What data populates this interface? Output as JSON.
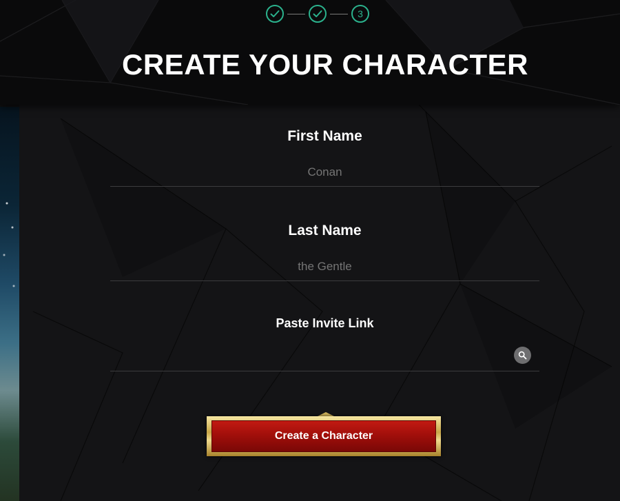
{
  "stepper": {
    "steps": [
      {
        "state": "complete",
        "icon": "check-icon",
        "label": ""
      },
      {
        "state": "complete",
        "icon": "check-icon",
        "label": ""
      },
      {
        "state": "current",
        "icon": "",
        "label": "3"
      }
    ],
    "accent_color": "#2bb28d"
  },
  "page": {
    "title": "CREATE YOUR CHARACTER"
  },
  "form": {
    "first_name": {
      "label": "First Name",
      "placeholder": "Conan",
      "value": ""
    },
    "last_name": {
      "label": "Last Name",
      "placeholder": "the Gentle",
      "value": ""
    },
    "invite_link": {
      "label": "Paste Invite Link",
      "placeholder": "",
      "value": "",
      "search_icon": "search-icon"
    },
    "submit": {
      "label": "Create a Character",
      "color": "#a50f0b",
      "frame_color": "#d9bb5e"
    }
  }
}
